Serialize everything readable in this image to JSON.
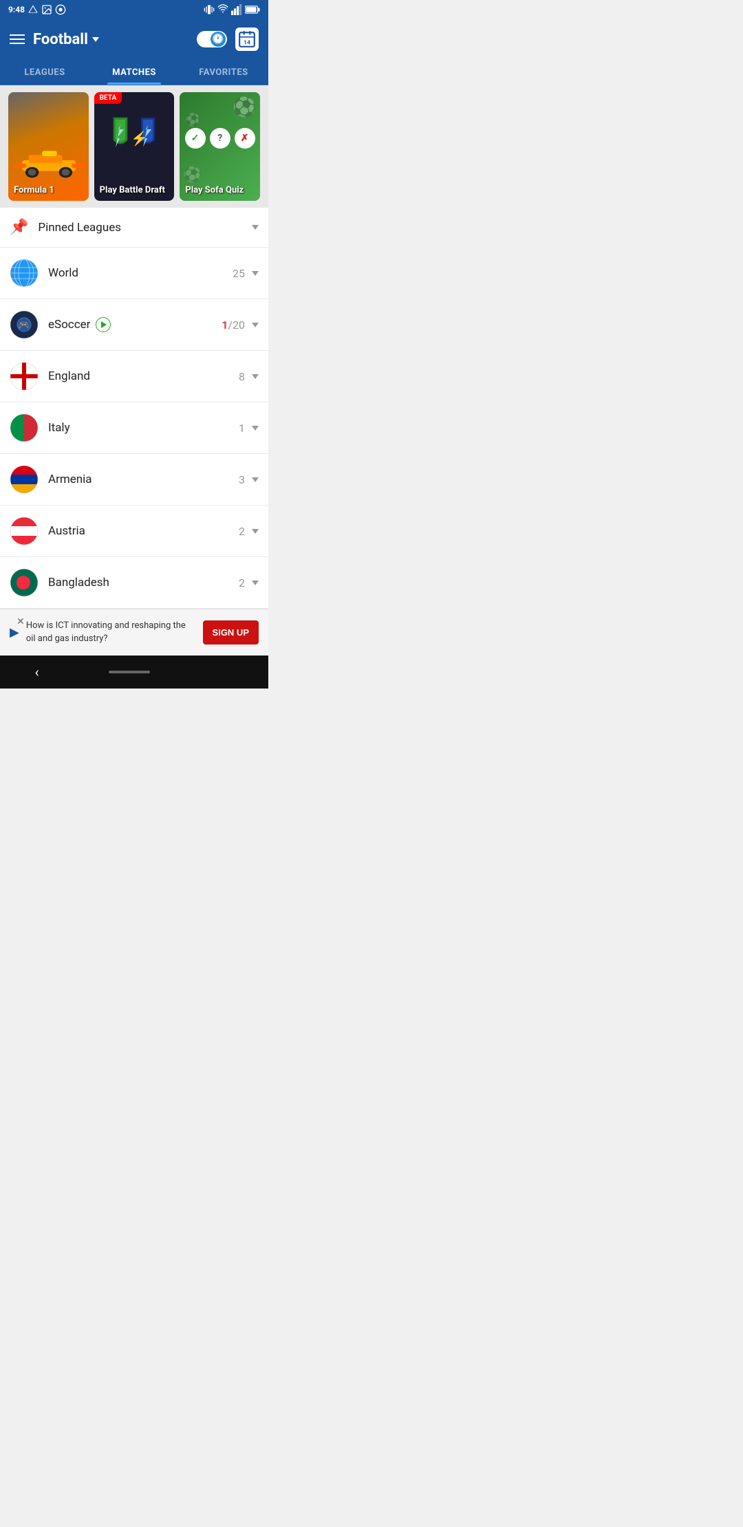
{
  "statusBar": {
    "time": "9:48",
    "icons": [
      "drive-icon",
      "image-icon",
      "circle-icon"
    ]
  },
  "header": {
    "menuLabel": "menu",
    "title": "Football",
    "calendarDate": "14"
  },
  "tabs": [
    {
      "id": "leagues",
      "label": "LEAGUES",
      "active": false
    },
    {
      "id": "matches",
      "label": "MATCHES",
      "active": true
    },
    {
      "id": "favorites",
      "label": "FAVORITES",
      "active": false
    }
  ],
  "promoCards": [
    {
      "id": "formula1",
      "label": "Formula 1",
      "type": "formula"
    },
    {
      "id": "battle-draft",
      "label": "Play Battle Draft",
      "type": "battle",
      "badge": "BETA"
    },
    {
      "id": "sofa-quiz",
      "label": "Play Sofa Quiz",
      "type": "quiz"
    }
  ],
  "pinnedLeagues": {
    "label": "Pinned Leagues"
  },
  "listItems": [
    {
      "id": "world",
      "name": "World",
      "count": "25",
      "liveCount": null,
      "flag": "world"
    },
    {
      "id": "esoccer",
      "name": "eSoccer",
      "count": "/20",
      "liveCount": "1",
      "flag": "esoccer",
      "live": true
    },
    {
      "id": "england",
      "name": "England",
      "count": "8",
      "liveCount": null,
      "flag": "england"
    },
    {
      "id": "italy",
      "name": "Italy",
      "count": "1",
      "liveCount": null,
      "flag": "italy"
    },
    {
      "id": "armenia",
      "name": "Armenia",
      "count": "3",
      "liveCount": null,
      "flag": "armenia"
    },
    {
      "id": "austria",
      "name": "Austria",
      "count": "2",
      "liveCount": null,
      "flag": "austria"
    },
    {
      "id": "bangladesh",
      "name": "Bangladesh",
      "count": "2",
      "liveCount": null,
      "flag": "bangladesh"
    }
  ],
  "adBanner": {
    "text": "How is ICT innovating and reshaping the oil and gas industry?",
    "signupLabel": "SIGN UP"
  }
}
